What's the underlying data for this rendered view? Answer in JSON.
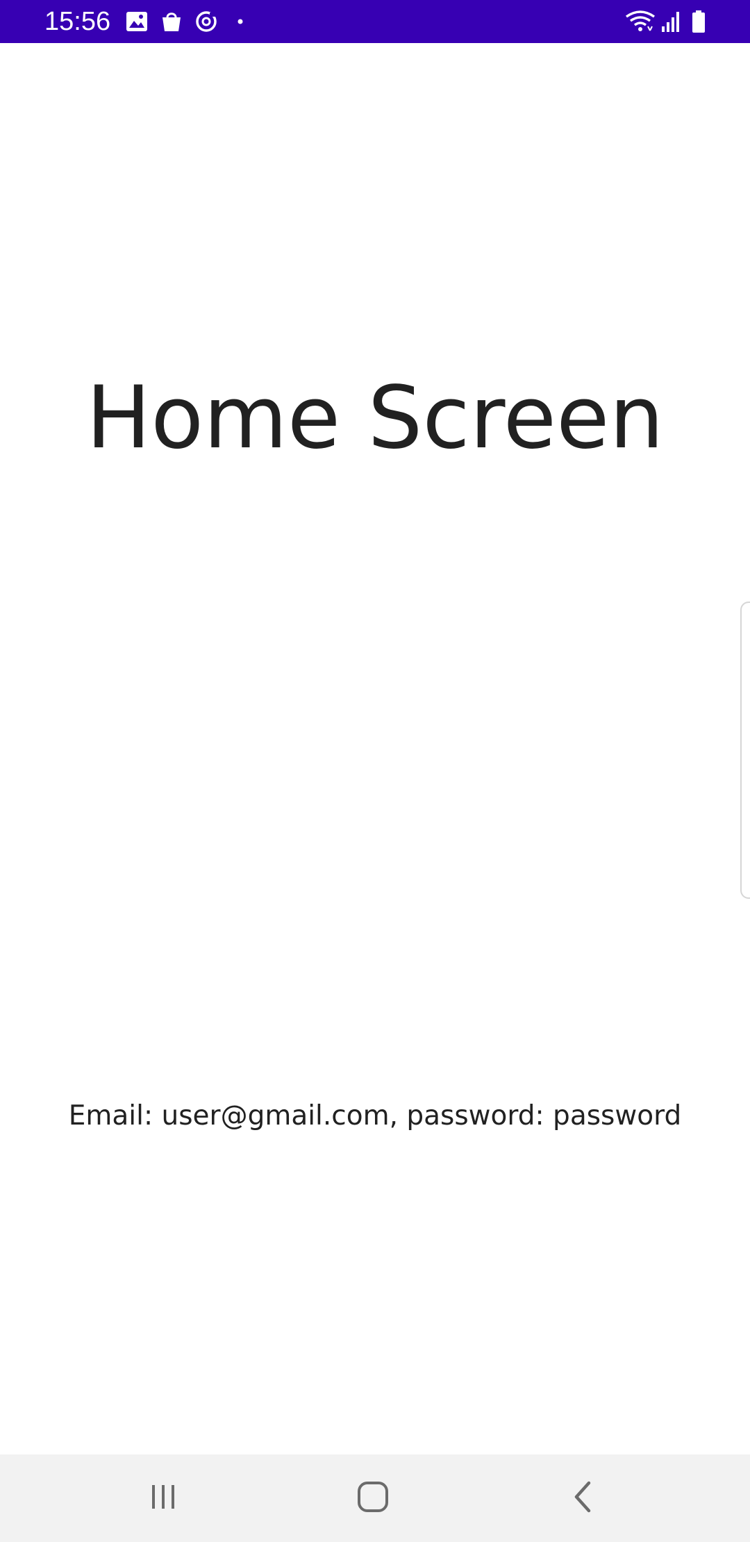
{
  "status_bar": {
    "time": "15:56",
    "background_color": "#3700b3",
    "left_icons": [
      "gallery-icon",
      "shopping-bag-icon",
      "sync-icon",
      "dot-icon"
    ],
    "right_icons": [
      "wifi-icon",
      "cell-signal-icon",
      "battery-icon"
    ]
  },
  "main": {
    "title": "Home Screen",
    "credentials": "Email: user@gmail.com, password: password"
  },
  "nav_bar": {
    "buttons": [
      "recent-apps-icon",
      "home-icon",
      "back-icon"
    ]
  }
}
